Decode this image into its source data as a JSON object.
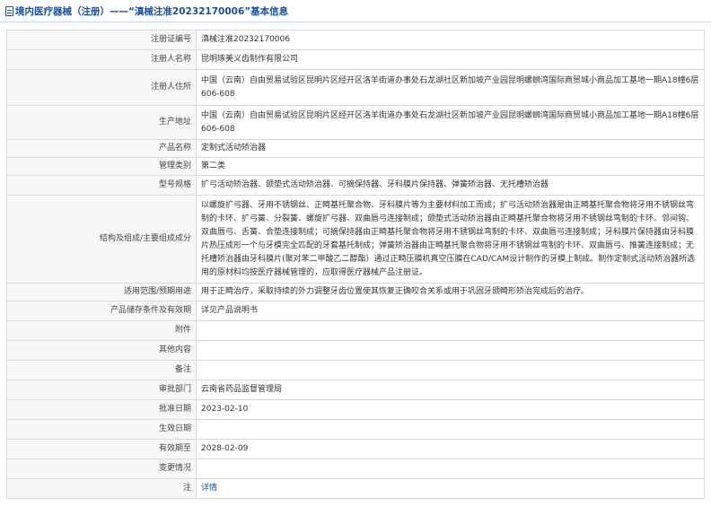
{
  "header": {
    "title": "境内医疗器械（注册）——“滇械注准20232170006”基本信息"
  },
  "rows": [
    {
      "label": "注册证编号",
      "value": "滇械注准20232170006"
    },
    {
      "label": "注册人名称",
      "value": "昆明琢美义齿制作有限公司"
    },
    {
      "label": "注册人住所",
      "value": "中国（云南）自由贸易试验区昆明片区经开区洛羊街道办事处石龙湖社区新加坡产业园昆明螺蛳湾国际商贸城小商品加工基地一期A18幢6层606-608"
    },
    {
      "label": "生产地址",
      "value": "中国（云南）自由贸易试验区昆明片区经开区洛羊街道办事处石龙湖社区新加坡产业园昆明螺蛳湾国际商贸城小商品加工基地一期A18幢6层606-608"
    },
    {
      "label": "产品名称",
      "value": "定制式活动矫治器"
    },
    {
      "label": "管理类别",
      "value": "第二类"
    },
    {
      "label": "型号规格",
      "value": "扩弓活动矫治器、颌垫式活动矫治器、可摘保持器、牙科膜片保持器、弹簧矫治器、无托槽矫治器"
    },
    {
      "label": "结构及组成/主要组成成分",
      "value": "以螺旋扩弓器、牙用不锈钢丝、正畸基托聚合物、牙科膜片等为主要材料加工而成；扩弓活动矫治器是由正畸基托聚合物将牙用不锈钢丝弯制的卡环、扩弓簧、分裂簧、螺旋扩弓器、双曲唇弓连接制成；颌垫式活动矫治器由正畸基托聚合物将牙用不锈钢丝弯制的卡环、邻间钩、双曲唇弓、舌簧、合垫连接制成；可摘保持器由正畸基托聚合物将牙用不锈钢丝弯制的卡环、双曲唇弓连接制成；牙科膜片保持器由牙科膜片热压成形一个与牙模完全匹配的牙套基托制成；弹簧矫治器由正畸基托聚合物将牙用不锈钢丝弯制的卡环、双曲唇弓、推簧连接制成；无托槽矫治器由牙科膜片(聚对苯二甲酸乙二醇酯）通过正畸压膜机真空压膜在CAD/CAM设计制作的牙模上制成。制作定制式活动矫治器所选用的原材料均按医疗器械管理的，应取得医疗器械产品注册证。"
    },
    {
      "label": "适用范围/预期用途",
      "value": "用于正畸治疗，采取持续的外力调整牙齿位置使其恢复正确咬合关系或用于巩固牙颌畸形矫治完成后的治疗。"
    },
    {
      "label": "产品储存条件及有效期",
      "value": "详见产品说明书"
    },
    {
      "label": "附件",
      "value": ""
    },
    {
      "label": "其他内容",
      "value": ""
    },
    {
      "label": "备注",
      "value": ""
    },
    {
      "label": "审批部门",
      "value": "云南省药品监督管理局"
    },
    {
      "label": "批准日期",
      "value": "2023-02-10"
    },
    {
      "label": "生效日期",
      "value": ""
    },
    {
      "label": "有效期至",
      "value": "2028-02-09"
    },
    {
      "label": "变更情况",
      "value": ""
    },
    {
      "label": "注",
      "value": "详情"
    }
  ]
}
